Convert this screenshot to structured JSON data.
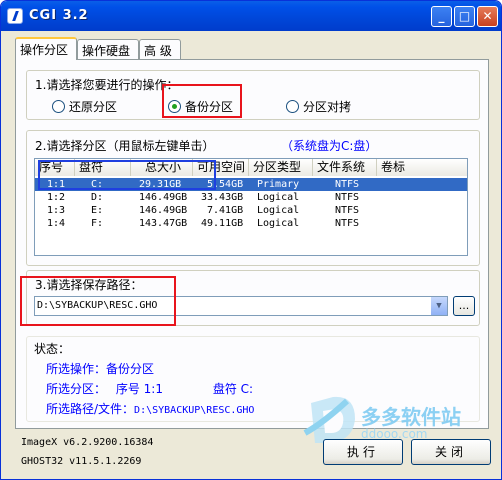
{
  "window": {
    "title": "CGI 3.2",
    "min": "_",
    "max": "□",
    "close": "✕"
  },
  "tabs": [
    {
      "label": "操作分区"
    },
    {
      "label": "操作硬盘"
    },
    {
      "label": "高 级"
    }
  ],
  "section1": {
    "label": "1.请选择您要进行的操作：",
    "options": [
      {
        "label": "还原分区",
        "selected": false
      },
      {
        "label": "备份分区",
        "selected": true
      },
      {
        "label": "分区对拷",
        "selected": false
      }
    ]
  },
  "section2": {
    "label": "2.请选择分区（用鼠标左键单击）",
    "system_disk": "（系统盘为C:盘）",
    "columns": [
      "序号",
      "盘符",
      "总大小",
      "可用空间",
      "分区类型",
      "文件系统",
      "卷标"
    ],
    "rows": [
      {
        "no": "1:1",
        "drive": "C:",
        "total": "29.31GB",
        "free": "5.54GB",
        "type": "Primary",
        "fs": "NTFS",
        "label": ""
      },
      {
        "no": "1:2",
        "drive": "D:",
        "total": "146.49GB",
        "free": "33.43GB",
        "type": "Logical",
        "fs": "NTFS",
        "label": ""
      },
      {
        "no": "1:3",
        "drive": "E:",
        "total": "146.49GB",
        "free": "7.41GB",
        "type": "Logical",
        "fs": "NTFS",
        "label": ""
      },
      {
        "no": "1:4",
        "drive": "F:",
        "total": "143.47GB",
        "free": "49.11GB",
        "type": "Logical",
        "fs": "NTFS",
        "label": ""
      }
    ]
  },
  "section3": {
    "label": "3.请选择保存路径：",
    "path": "D:\\SYBACKUP\\RESC.GHO",
    "browse": "..."
  },
  "status": {
    "label": "状态：",
    "op_label": "所选操作：",
    "op_value": "备份分区",
    "part_label": "所选分区：",
    "part_no": "序号 1:1",
    "drive_label": "盘符 C:",
    "path_label": "所选路径/文件：",
    "path_value": "D:\\SYBACKUP\\RESC.GHO"
  },
  "footer": {
    "imagex": "ImageX v6.2.9200.16384",
    "ghost": "GHOST32 v11.5.1.2269"
  },
  "buttons": {
    "execute": "执行",
    "close": "关闭"
  },
  "watermark": {
    "text": "多多软件站",
    "url": "ddooo.com"
  },
  "colors": {
    "selection": "#316ac5",
    "highlight_box": "#e8141c",
    "title_bar": "#0050e8",
    "status_text": "#0000ff"
  }
}
